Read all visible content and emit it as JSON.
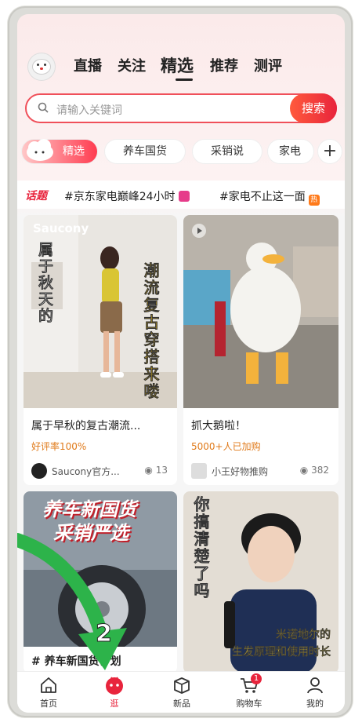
{
  "top_tabs": [
    "直播",
    "关注",
    "精选",
    "推荐",
    "测评"
  ],
  "active_tab": "精选",
  "search": {
    "placeholder": "请输入关键词",
    "button": "搜索"
  },
  "chips": [
    "精选",
    "养车国货",
    "采销说",
    "家电"
  ],
  "topics": {
    "logo": "话题",
    "items": [
      {
        "text": "#京东家电巅峰24小时",
        "badge_color": "#e63c8a"
      },
      {
        "text": "#家电不止这一面",
        "badge": "热",
        "badge_color": "#ff7a1a"
      }
    ]
  },
  "cards": [
    {
      "brand": "Saucony",
      "overlay_left": "属于秋天的",
      "overlay_right": "潮流复古穿搭来喽",
      "title": "属于早秋的复古潮流...",
      "meta": "好评率100%",
      "author": "Saucony官方...",
      "views": "13"
    },
    {
      "title": "抓大鹅啦！",
      "meta": "5000+人已加购",
      "author": "小王好物推购",
      "views": "382"
    },
    {
      "overlay_lines": [
        "养车新国货",
        "采销严选"
      ],
      "title": "# 养车新国货计划",
      "step_number": "2"
    },
    {
      "overlay_left": "你搞清楚了吗",
      "overlay_bottom": [
        "米诺地尔的",
        "生发原理和使用时长"
      ]
    }
  ],
  "bottom_nav": [
    {
      "label": "首页",
      "icon": "home-icon"
    },
    {
      "label": "逛",
      "icon": "stroll-icon"
    },
    {
      "label": "新品",
      "icon": "box-icon"
    },
    {
      "label": "购物车",
      "icon": "cart-icon",
      "badge": "1"
    },
    {
      "label": "我的",
      "icon": "user-icon"
    }
  ],
  "colors": {
    "accent": "#e8243c",
    "arrow": "#2db34a"
  }
}
